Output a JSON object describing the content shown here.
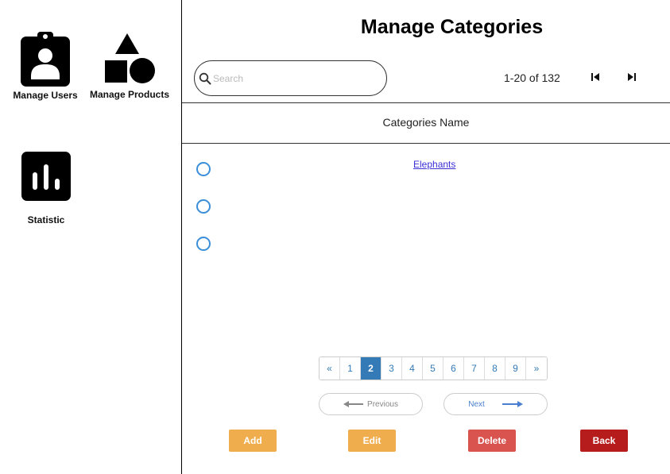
{
  "sidebar": {
    "items": [
      {
        "label": "Manage Users",
        "icon": "manage-users-icon"
      },
      {
        "label": "Manage Products",
        "icon": "shapes-icon"
      },
      {
        "label": "Statistic",
        "icon": "bar-chart-icon"
      }
    ]
  },
  "header": {
    "title": "Manage Categories",
    "search_placeholder": "Search",
    "range": "1-20 of 132"
  },
  "table": {
    "column_header": "Categories Name",
    "rows": [
      {
        "name": "Elephants",
        "selected": false
      },
      {
        "name": "",
        "selected": false
      },
      {
        "name": "",
        "selected": false
      }
    ]
  },
  "pagination": {
    "prev_symbol": "«",
    "next_symbol": "»",
    "pages": [
      "1",
      "2",
      "3",
      "4",
      "5",
      "6",
      "7",
      "8",
      "9"
    ],
    "active_page": "2",
    "previous_label": "Previous",
    "next_label": "Next"
  },
  "actions": {
    "add": {
      "label": "Add",
      "color": "#f0ad4e"
    },
    "edit": {
      "label": "Edit",
      "color": "#f0ad4e"
    },
    "delete": {
      "label": "Delete",
      "color": "#d9534f"
    },
    "back": {
      "label": "Back",
      "color": "#b71c1c"
    }
  },
  "colors": {
    "radio": "#3a8fd8",
    "link": "#3b2fd6",
    "pager_active": "#337ab7"
  }
}
